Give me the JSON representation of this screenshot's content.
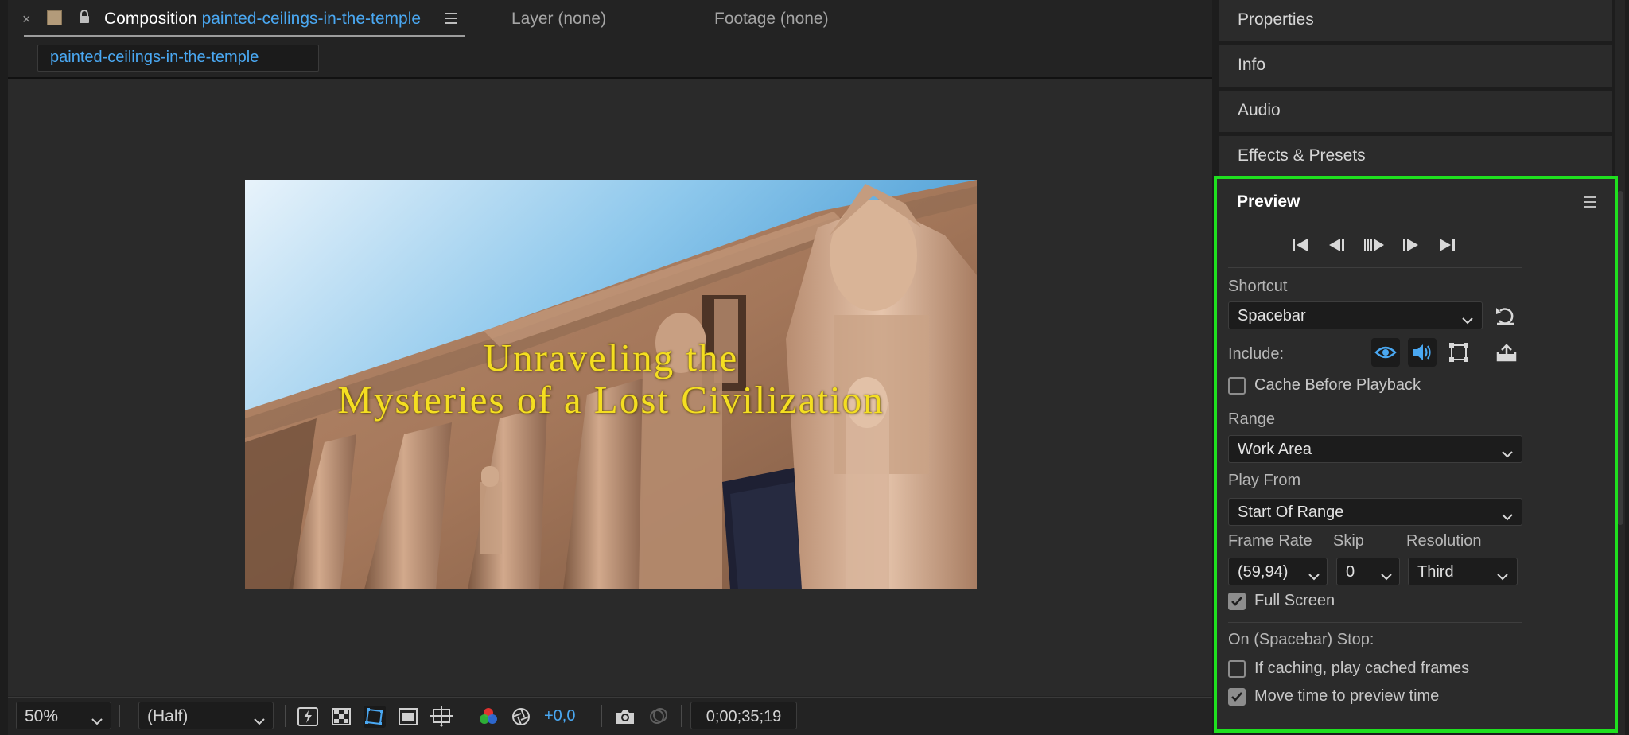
{
  "comp_tab": {
    "close": "×",
    "prefix": "Composition",
    "name": "painted-ceilings-in-the-temple",
    "breadcrumb": "painted-ceilings-in-the-temple"
  },
  "other_tabs": {
    "layer": "Layer (none)",
    "footage": "Footage (none)"
  },
  "canvas_title": {
    "line1": "Unraveling the",
    "line2": "Mysteries of a Lost Civilization"
  },
  "viewer_toolbar": {
    "zoom": "50%",
    "resolution": "(Half)",
    "exposure": "+0,0",
    "timecode": "0;00;35;19"
  },
  "right_panels": [
    "Properties",
    "Info",
    "Audio",
    "Effects & Presets"
  ],
  "preview": {
    "title": "Preview",
    "shortcut_label": "Shortcut",
    "shortcut_value": "Spacebar",
    "include_label": "Include:",
    "cache_before_playback": "Cache Before Playback",
    "range_label": "Range",
    "range_value": "Work Area",
    "play_from_label": "Play From",
    "play_from_value": "Start Of Range",
    "frame_rate_label": "Frame Rate",
    "frame_rate_value": "(59,94)",
    "skip_label": "Skip",
    "skip_value": "0",
    "resolution_label": "Resolution",
    "resolution_value": "Third",
    "full_screen": "Full Screen",
    "on_stop_label": "On (Spacebar) Stop:",
    "if_caching": "If caching, play cached frames",
    "move_time": "Move time to preview time",
    "checkboxes": {
      "cache_before_playback": false,
      "full_screen": true,
      "if_caching": false,
      "move_time": true
    }
  },
  "colors": {
    "highlight": "#1fe01f",
    "accent": "#4aa8f2",
    "title_yellow": "#f4de21"
  }
}
